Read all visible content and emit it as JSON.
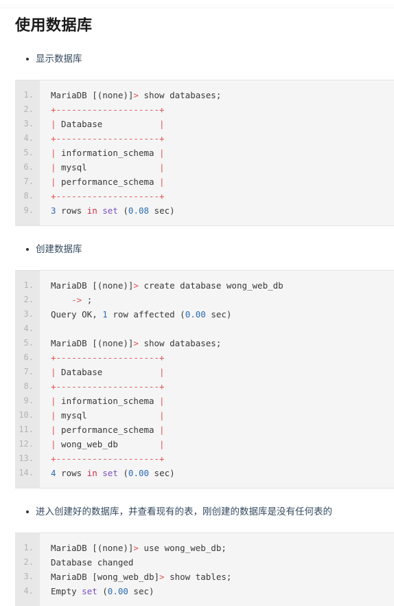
{
  "page": {
    "title": "使用数据库"
  },
  "sections": [
    {
      "bullet": "显示数据库",
      "code": {
        "line_numbers": [
          "1.",
          "2.",
          "3.",
          "4.",
          "5.",
          "6.",
          "7.",
          "8.",
          "9."
        ],
        "lines": [
          [
            {
              "t": "MariaDB [(none)]",
              "c": "plain"
            },
            {
              "t": ">",
              "c": "punct"
            },
            {
              "t": " show databases;",
              "c": "plain"
            }
          ],
          [
            {
              "t": "+--------------------+",
              "c": "punct"
            }
          ],
          [
            {
              "t": "|",
              "c": "punct"
            },
            {
              "t": " Database           ",
              "c": "plain"
            },
            {
              "t": "|",
              "c": "punct"
            }
          ],
          [
            {
              "t": "+--------------------+",
              "c": "punct"
            }
          ],
          [
            {
              "t": "|",
              "c": "punct"
            },
            {
              "t": " information_schema ",
              "c": "plain"
            },
            {
              "t": "|",
              "c": "punct"
            }
          ],
          [
            {
              "t": "|",
              "c": "punct"
            },
            {
              "t": " mysql              ",
              "c": "plain"
            },
            {
              "t": "|",
              "c": "punct"
            }
          ],
          [
            {
              "t": "|",
              "c": "punct"
            },
            {
              "t": " performance_schema ",
              "c": "plain"
            },
            {
              "t": "|",
              "c": "punct"
            }
          ],
          [
            {
              "t": "+--------------------+",
              "c": "punct"
            }
          ],
          [
            {
              "t": "3",
              "c": "num"
            },
            {
              "t": " rows ",
              "c": "plain"
            },
            {
              "t": "in",
              "c": "kw"
            },
            {
              "t": " ",
              "c": "plain"
            },
            {
              "t": "set",
              "c": "kw2"
            },
            {
              "t": " (",
              "c": "plain"
            },
            {
              "t": "0.08",
              "c": "num"
            },
            {
              "t": " sec)",
              "c": "plain"
            }
          ]
        ]
      }
    },
    {
      "bullet": "创建数据库",
      "code": {
        "line_numbers": [
          "1.",
          "2.",
          "3.",
          "4.",
          "5.",
          "6.",
          "7.",
          "8.",
          "9.",
          "10.",
          "11.",
          "12.",
          "13.",
          "14."
        ],
        "lines": [
          [
            {
              "t": "MariaDB [(none)]",
              "c": "plain"
            },
            {
              "t": ">",
              "c": "punct"
            },
            {
              "t": " create database wong_web_db",
              "c": "plain"
            }
          ],
          [
            {
              "t": "    ",
              "c": "plain"
            },
            {
              "t": "->",
              "c": "punct"
            },
            {
              "t": " ;",
              "c": "plain"
            }
          ],
          [
            {
              "t": "Query OK, ",
              "c": "plain"
            },
            {
              "t": "1",
              "c": "num"
            },
            {
              "t": " row affected (",
              "c": "plain"
            },
            {
              "t": "0.00",
              "c": "num"
            },
            {
              "t": " sec)",
              "c": "plain"
            }
          ],
          [
            {
              "t": "",
              "c": "plain"
            }
          ],
          [
            {
              "t": "MariaDB [(none)]",
              "c": "plain"
            },
            {
              "t": ">",
              "c": "punct"
            },
            {
              "t": " show databases;",
              "c": "plain"
            }
          ],
          [
            {
              "t": "+--------------------+",
              "c": "punct"
            }
          ],
          [
            {
              "t": "|",
              "c": "punct"
            },
            {
              "t": " Database           ",
              "c": "plain"
            },
            {
              "t": "|",
              "c": "punct"
            }
          ],
          [
            {
              "t": "+--------------------+",
              "c": "punct"
            }
          ],
          [
            {
              "t": "|",
              "c": "punct"
            },
            {
              "t": " information_schema ",
              "c": "plain"
            },
            {
              "t": "|",
              "c": "punct"
            }
          ],
          [
            {
              "t": "|",
              "c": "punct"
            },
            {
              "t": " mysql              ",
              "c": "plain"
            },
            {
              "t": "|",
              "c": "punct"
            }
          ],
          [
            {
              "t": "|",
              "c": "punct"
            },
            {
              "t": " performance_schema ",
              "c": "plain"
            },
            {
              "t": "|",
              "c": "punct"
            }
          ],
          [
            {
              "t": "|",
              "c": "punct"
            },
            {
              "t": " wong_web_db        ",
              "c": "plain"
            },
            {
              "t": "|",
              "c": "punct"
            }
          ],
          [
            {
              "t": "+--------------------+",
              "c": "punct"
            }
          ],
          [
            {
              "t": "4",
              "c": "num"
            },
            {
              "t": " rows ",
              "c": "plain"
            },
            {
              "t": "in",
              "c": "kw"
            },
            {
              "t": " ",
              "c": "plain"
            },
            {
              "t": "set",
              "c": "kw2"
            },
            {
              "t": " (",
              "c": "plain"
            },
            {
              "t": "0.00",
              "c": "num"
            },
            {
              "t": " sec)",
              "c": "plain"
            }
          ]
        ]
      }
    },
    {
      "bullet": "进入创建好的数据库，并查看现有的表，刚创建的数据库是没有任何表的",
      "code": {
        "line_numbers": [
          "1.",
          "2.",
          "3.",
          "4."
        ],
        "lines": [
          [
            {
              "t": "MariaDB [(none)]",
              "c": "plain"
            },
            {
              "t": ">",
              "c": "punct"
            },
            {
              "t": " use wong_web_db;",
              "c": "plain"
            }
          ],
          [
            {
              "t": "Database changed",
              "c": "plain"
            }
          ],
          [
            {
              "t": "MariaDB [wong_web_db]",
              "c": "plain"
            },
            {
              "t": ">",
              "c": "punct"
            },
            {
              "t": " show tables;",
              "c": "plain"
            }
          ],
          [
            {
              "t": "Empty ",
              "c": "plain"
            },
            {
              "t": "set",
              "c": "kw2"
            },
            {
              "t": " (",
              "c": "plain"
            },
            {
              "t": "0.00",
              "c": "num"
            },
            {
              "t": " sec)",
              "c": "plain"
            }
          ]
        ]
      }
    }
  ],
  "colors": {
    "title": "#1a1a1a",
    "body_text": "#34495e",
    "code_bg": "#f5f5f5",
    "gutter_bg": "#e8e8e8",
    "gutter_text": "#b3b3b3",
    "token_punct": "#e05252",
    "token_number": "#2b6cb0",
    "token_keyword": "#d32a4b",
    "token_keyword_alt": "#7b4fc4",
    "token_plain": "#383838"
  }
}
